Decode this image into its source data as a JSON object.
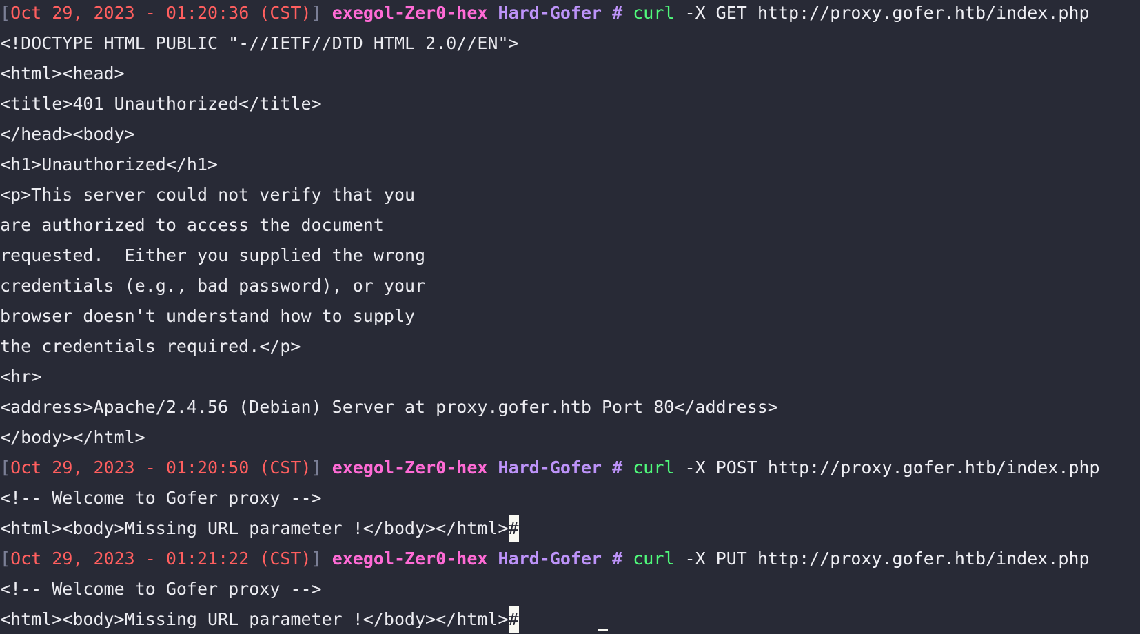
{
  "colors": {
    "background": "#282a36",
    "timestamp": "#ff5f5f",
    "user": "#ff6bd6",
    "host": "#bd93f9",
    "command": "#50fa7b",
    "text": "#ececf1"
  },
  "prompts": [
    {
      "open_bracket": "[",
      "timestamp": "Oct 29, 2023 - 01:20:36 (CST)",
      "close_bracket": "]",
      "user": "exegol-Zer0-hex",
      "host": "Hard-Gofer",
      "symbol": "#",
      "command": "curl",
      "args": "-X GET http://proxy.gofer.htb/index.php"
    },
    {
      "open_bracket": "[",
      "timestamp": "Oct 29, 2023 - 01:20:50 (CST)",
      "close_bracket": "]",
      "user": "exegol-Zer0-hex",
      "host": "Hard-Gofer",
      "symbol": "#",
      "command": "curl",
      "args": "-X POST http://proxy.gofer.htb/index.php"
    },
    {
      "open_bracket": "[",
      "timestamp": "Oct 29, 2023 - 01:21:22 (CST)",
      "close_bracket": "]",
      "user": "exegol-Zer0-hex",
      "host": "Hard-Gofer",
      "symbol": "#",
      "command": "curl",
      "args": "-X PUT http://proxy.gofer.htb/index.php"
    }
  ],
  "outputs": [
    [
      "<!DOCTYPE HTML PUBLIC \"-//IETF//DTD HTML 2.0//EN\">",
      "<html><head>",
      "<title>401 Unauthorized</title>",
      "</head><body>",
      "<h1>Unauthorized</h1>",
      "<p>This server could not verify that you",
      "are authorized to access the document",
      "requested.  Either you supplied the wrong",
      "credentials (e.g., bad password), or your",
      "browser doesn't understand how to supply",
      "the credentials required.</p>",
      "<hr>",
      "<address>Apache/2.4.56 (Debian) Server at proxy.gofer.htb Port 80</address>",
      "</body></html>"
    ],
    [
      "<!-- Welcome to Gofer proxy -->",
      "<html><body>Missing URL parameter !</body></html>"
    ],
    [
      "<!-- Welcome to Gofer proxy -->",
      "<html><body>Missing URL parameter !</body></html>"
    ]
  ],
  "cursor_glyph": "#"
}
